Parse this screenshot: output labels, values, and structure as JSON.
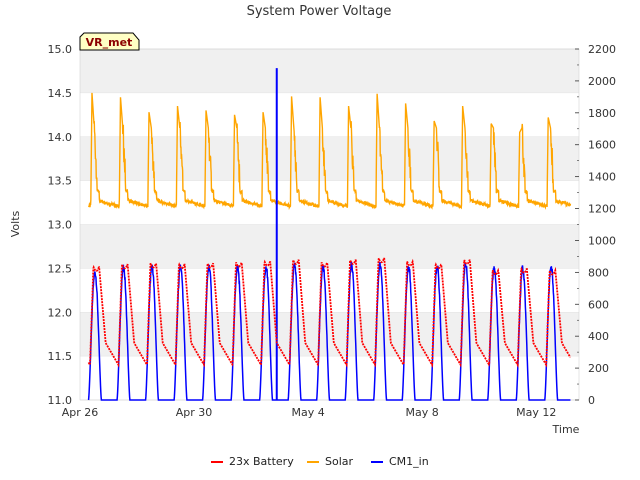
{
  "chart_data": {
    "type": "line",
    "title": "System Power Voltage",
    "xlabel": "Time",
    "ylabel": "Volts",
    "badge": "VR_met",
    "x_axis": {
      "range_days": [
        0,
        17.5
      ],
      "ticks": [
        {
          "day": 0,
          "label": "Apr 26"
        },
        {
          "day": 4,
          "label": "Apr 30"
        },
        {
          "day": 8,
          "label": "May 4"
        },
        {
          "day": 12,
          "label": "May 8"
        },
        {
          "day": 16,
          "label": "May 12"
        }
      ]
    },
    "y_left": {
      "range": [
        11.0,
        15.0
      ],
      "ticks": [
        "11.0",
        "11.5",
        "12.0",
        "12.5",
        "13.0",
        "13.5",
        "14.0",
        "14.5",
        "15.0"
      ]
    },
    "y_right": {
      "range": [
        0,
        2200
      ],
      "ticks": [
        "0",
        "200",
        "400",
        "600",
        "800",
        "1000",
        "1200",
        "1400",
        "1600",
        "1800",
        "2000",
        "2200"
      ]
    },
    "grid": "horizontal bands",
    "legend_position": "bottom-center",
    "series": [
      {
        "name": "23x Battery",
        "axis": "left",
        "color": "#ff0000",
        "daily_peak_volts": [
          12.52,
          12.55,
          12.56,
          12.55,
          12.56,
          12.57,
          12.58,
          12.6,
          12.57,
          12.6,
          12.62,
          12.58,
          12.55,
          12.6,
          12.48,
          12.5,
          12.48
        ],
        "night_min_volts": 11.4
      },
      {
        "name": "Solar",
        "axis": "left",
        "color": "#ffa500",
        "daily_peak_volts": [
          14.5,
          14.45,
          14.28,
          14.35,
          14.3,
          14.25,
          14.28,
          14.46,
          14.45,
          14.35,
          14.49,
          14.38,
          14.18,
          14.35,
          14.15,
          14.05,
          14.22
        ],
        "night_min_volts": 13.2
      },
      {
        "name": "CM1_in",
        "axis": "right",
        "color": "#0000ff",
        "daily_peak_values": [
          820,
          850,
          860,
          855,
          860,
          860,
          860,
          870,
          860,
          870,
          875,
          860,
          860,
          880,
          850,
          850,
          860
        ],
        "spike": {
          "day": 6.9,
          "value": 2080
        }
      }
    ]
  }
}
